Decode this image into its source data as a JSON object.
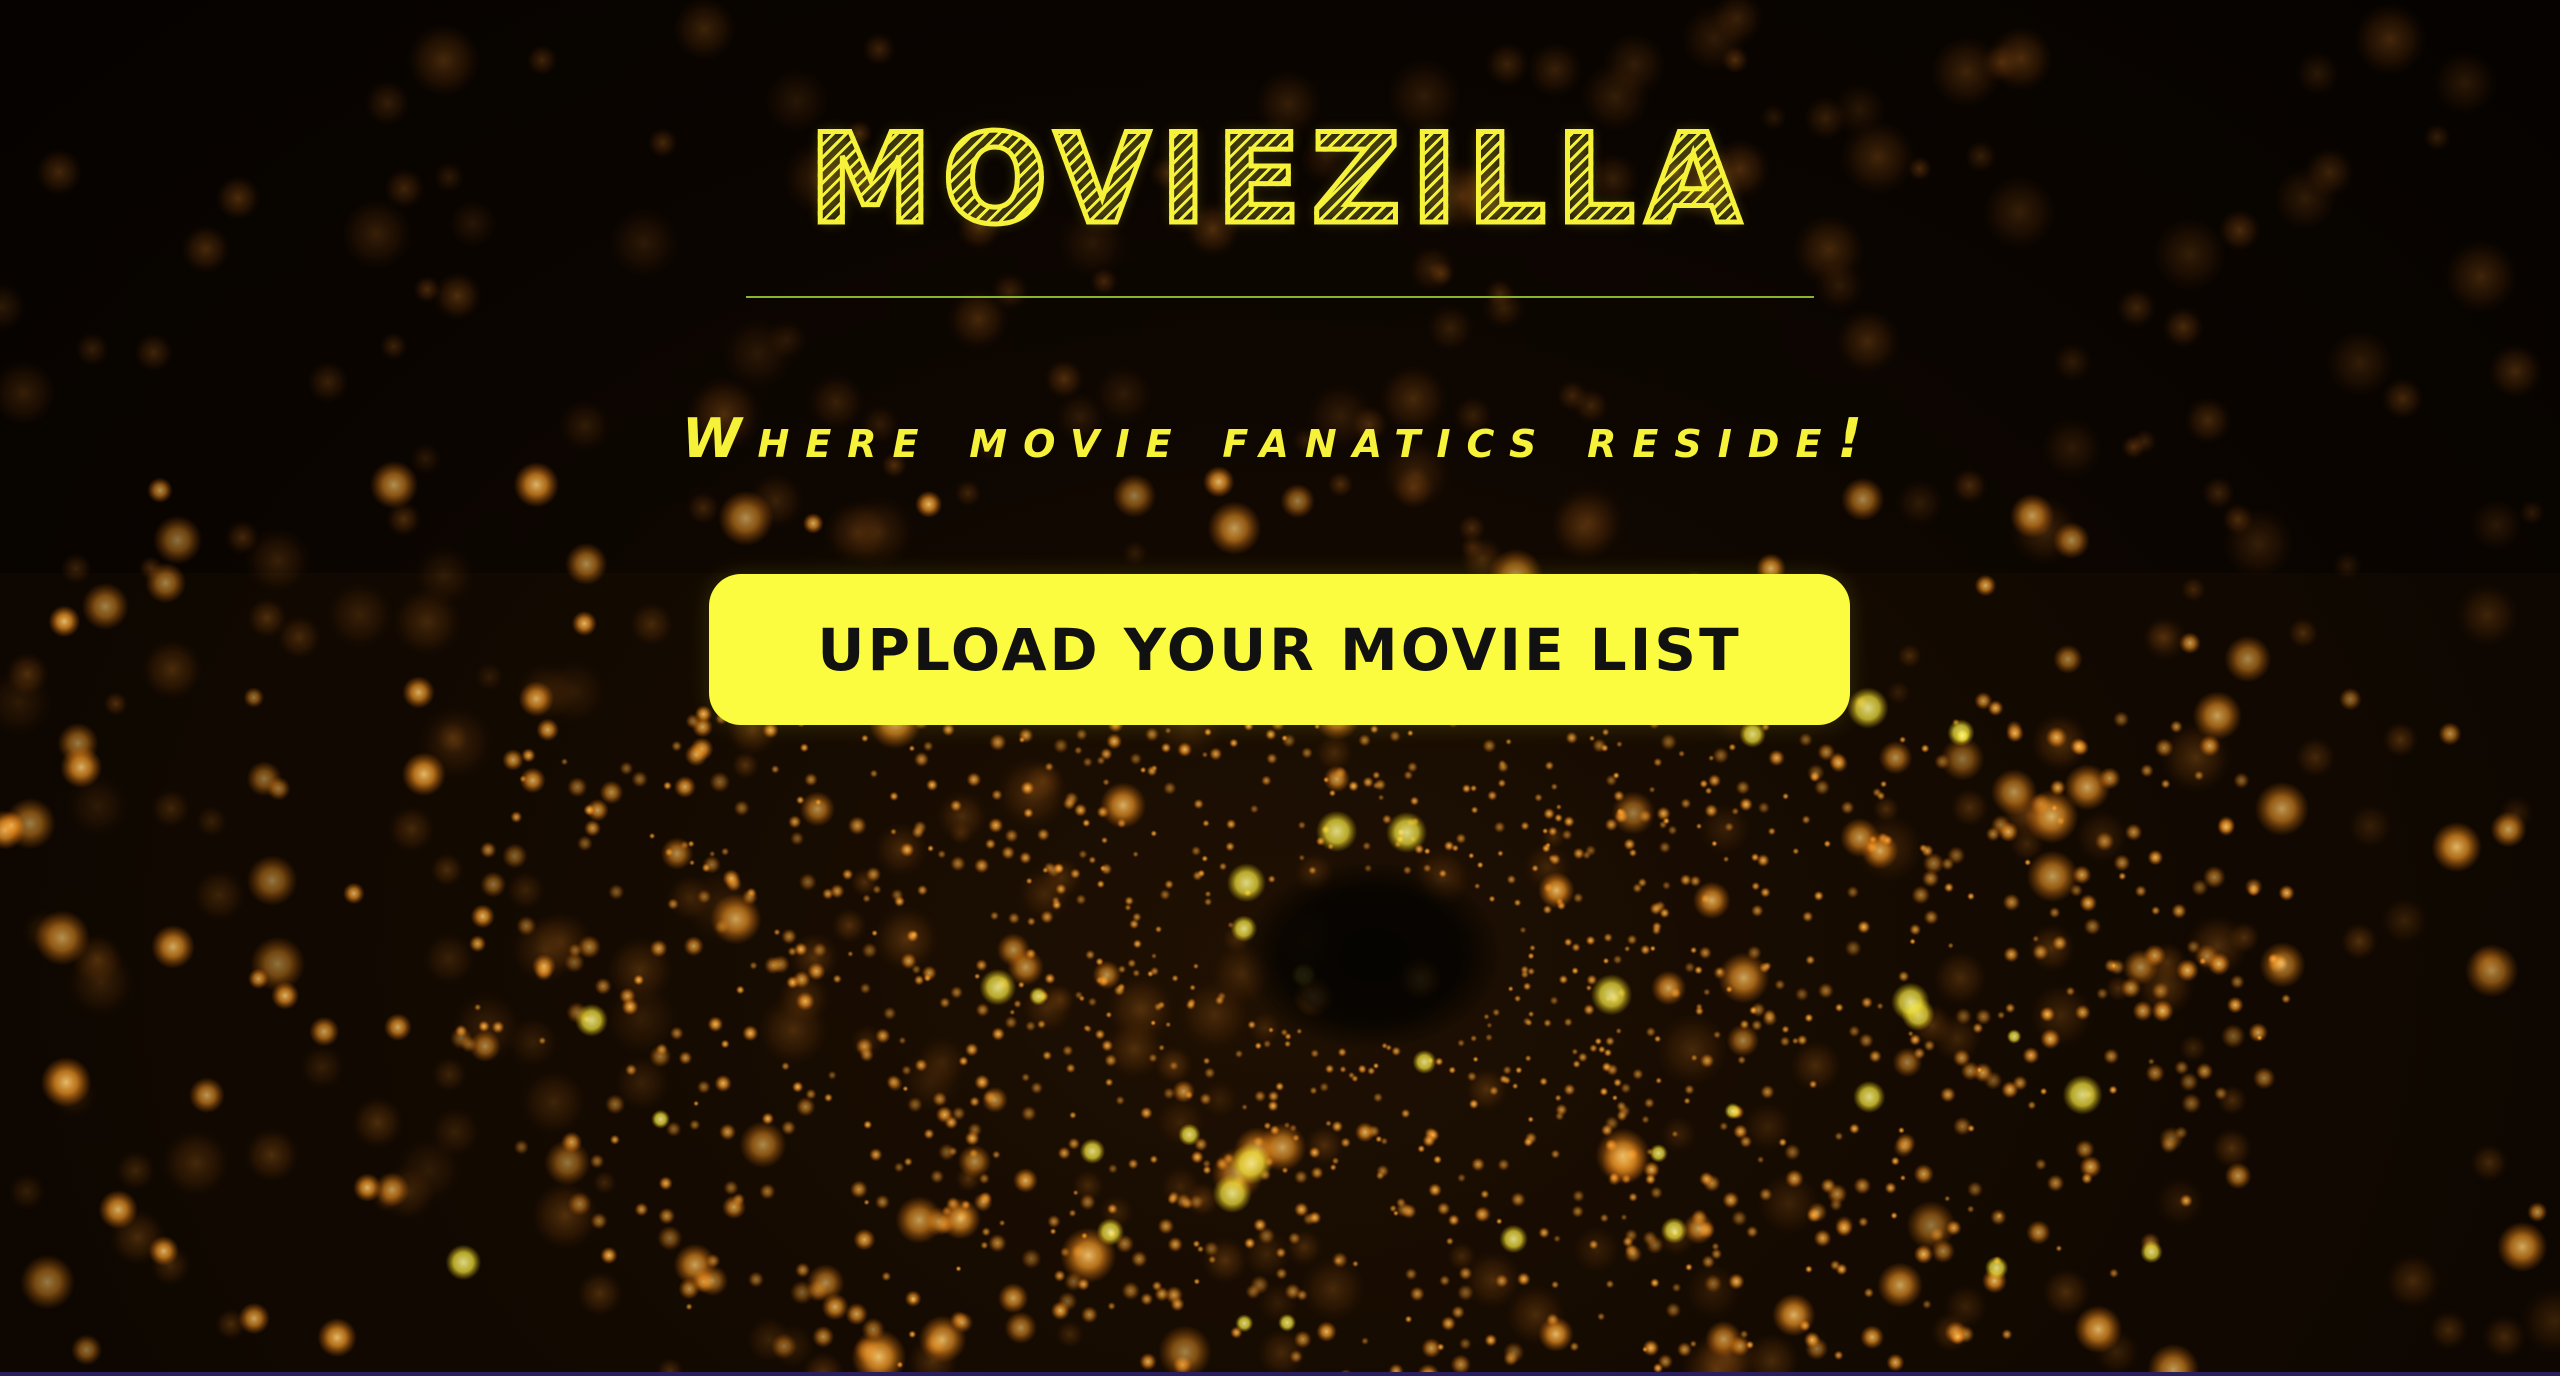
{
  "app": {
    "title": "MOVIEZILLA",
    "tagline": "Where movie fanatics reside!"
  },
  "actions": {
    "upload_label": "UPLOAD YOUR MOVIE LIST"
  },
  "colors": {
    "accent": "#f6f23a",
    "button_bg": "#fbfb3f",
    "button_text": "#111111",
    "divider": "#8ab52a",
    "background": "#050200",
    "bokeh": "#ffa62b"
  },
  "background": {
    "image": "golden-bokeh-particles"
  }
}
